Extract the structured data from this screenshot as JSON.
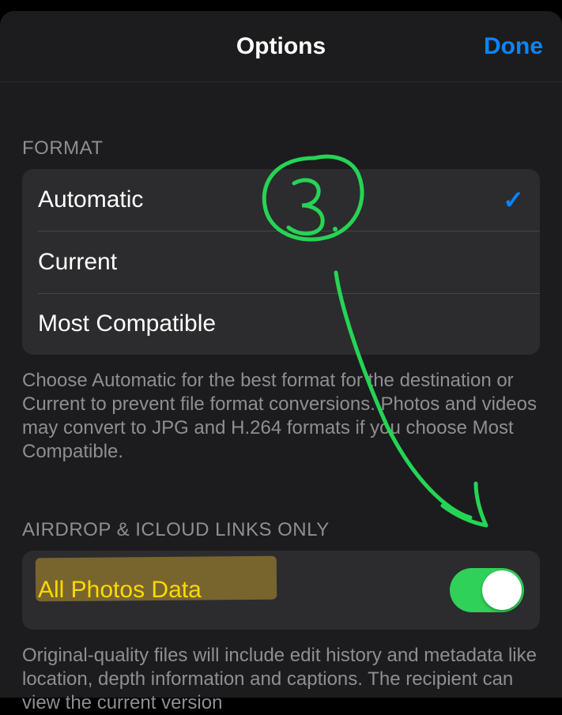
{
  "nav": {
    "title": "Options",
    "done": "Done"
  },
  "format": {
    "header": "FORMAT",
    "options": {
      "automatic": "Automatic",
      "current": "Current",
      "mostCompatible": "Most Compatible"
    },
    "footer": "Choose Automatic for the best format for the destination or Current to prevent file format conversions. Photos and videos may convert to JPG and H.264 formats if you choose Most Compatible."
  },
  "airdrop": {
    "header": "AIRDROP & ICLOUD LINKS ONLY",
    "allPhotosData": "All Photos Data",
    "footer": "Original-quality files will include edit history and metadata like location, depth information and captions. The recipient can view the current version"
  },
  "annotation": {
    "number": "3."
  },
  "colors": {
    "accent": "#0a84ff",
    "switchOn": "#30d158",
    "annotationGreen": "#26d455",
    "highlight": "#ffcc00"
  }
}
